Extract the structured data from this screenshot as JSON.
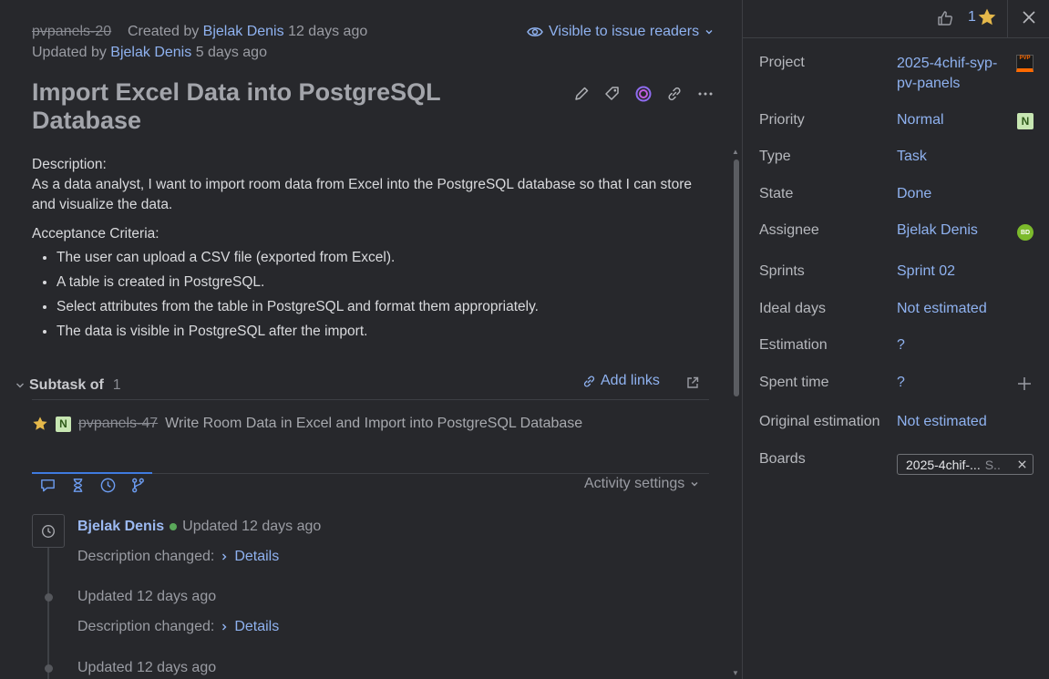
{
  "issue": {
    "id": "pvpanels-20",
    "created_prefix": "Created by",
    "created_by": "Bjelak Denis",
    "created_ago": "12 days ago",
    "updated_prefix": "Updated by",
    "updated_by": "Bjelak Denis",
    "updated_ago": "5 days ago",
    "visibility_label": "Visible to issue readers",
    "title": "Import Excel Data into PostgreSQL Database"
  },
  "description": {
    "heading": "Description:",
    "text": "As a data analyst, I want to import room data from Excel into the PostgreSQL database so that I can store and visualize the data.",
    "criteria_heading": "Acceptance Criteria:",
    "criteria": [
      "The user can upload a CSV file (exported from Excel).",
      "A table is created in PostgreSQL.",
      "Select attributes from the table in PostgreSQL and format them appropriately.",
      "The data is visible in PostgreSQL after the import."
    ]
  },
  "subtasks": {
    "title": "Subtask of",
    "count": "1",
    "add_links_label": "Add links",
    "item": {
      "badge": "N",
      "id": "pvpanels-47",
      "summary": "Write Room Data in Excel and Import into PostgreSQL Database"
    }
  },
  "activity": {
    "settings_label": "Activity settings",
    "entries": [
      {
        "author": "Bjelak Denis",
        "action": "Updated 12 days ago",
        "change": "Description changed:",
        "details": "Details"
      },
      {
        "action": "Updated 12 days ago",
        "change": "Description changed:",
        "details": "Details"
      },
      {
        "action": "Updated 12 days ago"
      }
    ]
  },
  "sidebar": {
    "vote_count": "1",
    "fields": {
      "project_label": "Project",
      "project_value": "2025-4chif-syp-pv-panels",
      "project_icon_text": "PVP",
      "priority_label": "Priority",
      "priority_value": "Normal",
      "priority_badge": "N",
      "type_label": "Type",
      "type_value": "Task",
      "state_label": "State",
      "state_value": "Done",
      "assignee_label": "Assignee",
      "assignee_value": "Bjelak Denis",
      "assignee_initials": "BD",
      "sprints_label": "Sprints",
      "sprints_value": "Sprint 02",
      "ideal_days_label": "Ideal days",
      "ideal_days_value": "Not estimated",
      "estimation_label": "Estimation",
      "estimation_value": "?",
      "spent_time_label": "Spent time",
      "spent_time_value": "?",
      "original_estimation_label": "Original estimation",
      "original_estimation_value": "Not estimated",
      "boards_label": "Boards",
      "board_chip": "2025-4chif-...",
      "board_chip_sprint": "S.."
    }
  },
  "colors": {
    "background": "#27282c",
    "link": "#8fb2f0",
    "accent": "#3f7be0",
    "priority_badge": "#c7e6b2",
    "star": "#e5b84a"
  }
}
